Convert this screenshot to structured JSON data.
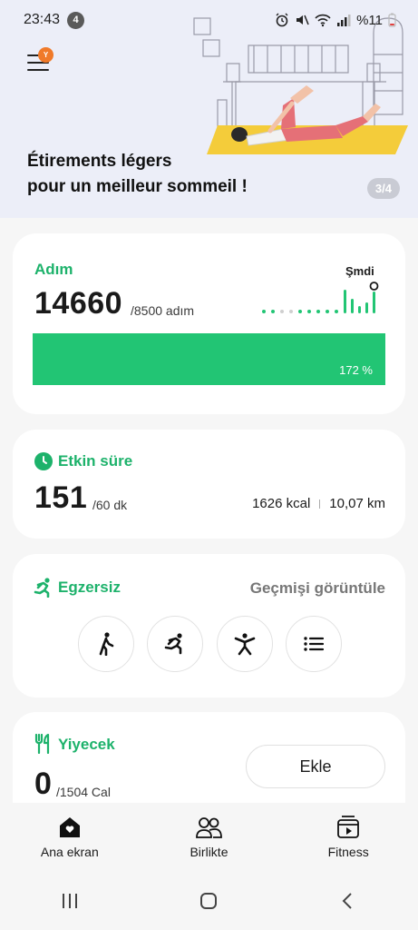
{
  "status_bar": {
    "time": "23:43",
    "notification_count": "4",
    "battery": "%11"
  },
  "banner": {
    "menu_badge": "Y",
    "title_line1": "Étirements légers",
    "title_line2": "pour un meilleur sommeil !",
    "pager": "3/4"
  },
  "steps": {
    "title": "Adım",
    "value": "14660",
    "goal": "/8500 adım",
    "now_label": "Şmdi",
    "percent_text": "172 %",
    "progress_fraction": 1.0
  },
  "active_time": {
    "title": "Etkin süre",
    "value": "151",
    "goal": "/60 dk",
    "calories": "1626 kcal",
    "distance": "10,07 km"
  },
  "exercise": {
    "title": "Egzersiz",
    "history_label": "Geçmişi görüntüle",
    "buttons": [
      "walking-icon",
      "running-icon",
      "workout-icon",
      "list-icon"
    ]
  },
  "food": {
    "title": "Yiyecek",
    "value": "0",
    "goal": "/1504 Cal",
    "add_label": "Ekle"
  },
  "nav": {
    "home": "Ana ekran",
    "together": "Birlikte",
    "fitness": "Fitness"
  },
  "colors": {
    "accent": "#1db26b",
    "banner_bg": "#eceef8",
    "bar": "#22c574"
  }
}
